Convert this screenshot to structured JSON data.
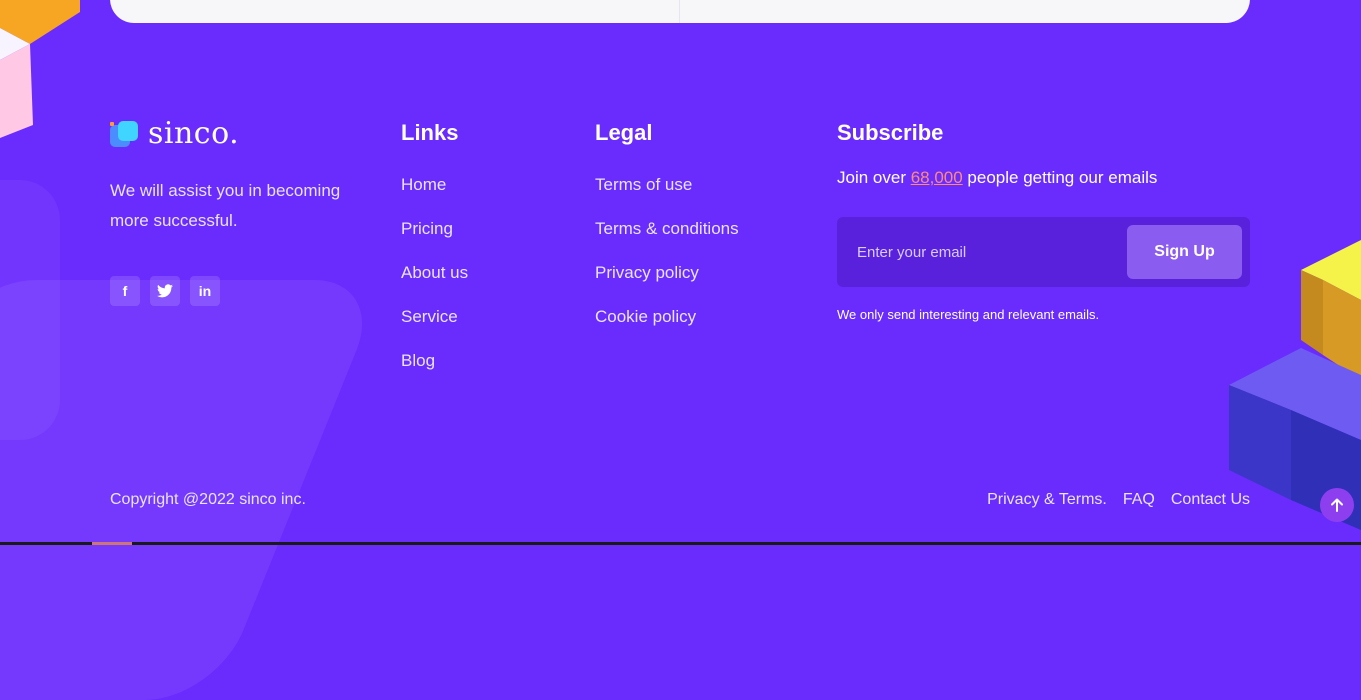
{
  "brand": {
    "name": "sinco.",
    "tagline": "We will assist you in becoming more successful."
  },
  "socials": [
    {
      "icon": "facebook-icon",
      "glyph": "f"
    },
    {
      "icon": "twitter-icon",
      "glyph": "t"
    },
    {
      "icon": "linkedin-icon",
      "glyph": "in"
    }
  ],
  "links": {
    "heading": "Links",
    "items": [
      "Home",
      "Pricing",
      "About us",
      "Service",
      "Blog"
    ]
  },
  "legal": {
    "heading": "Legal",
    "items": [
      "Terms of use",
      "Terms & conditions",
      "Privacy policy",
      "Cookie policy"
    ]
  },
  "subscribe": {
    "heading": "Subscribe",
    "text_before": "Join over ",
    "count": "68,000",
    "text_after": " people getting our emails",
    "placeholder": "Enter your email",
    "button": "Sign Up",
    "note": "We only send interesting and relevant emails."
  },
  "footer": {
    "copyright": "Copyright @2022 sinco inc.",
    "links": [
      "Privacy & Terms.",
      "FAQ",
      "Contact Us"
    ]
  },
  "colors": {
    "background": "#6a2bfd",
    "accent": "#8a5cf0",
    "highlight": "#ff8a7a"
  },
  "scroll_top_icon": "arrow-up-icon"
}
